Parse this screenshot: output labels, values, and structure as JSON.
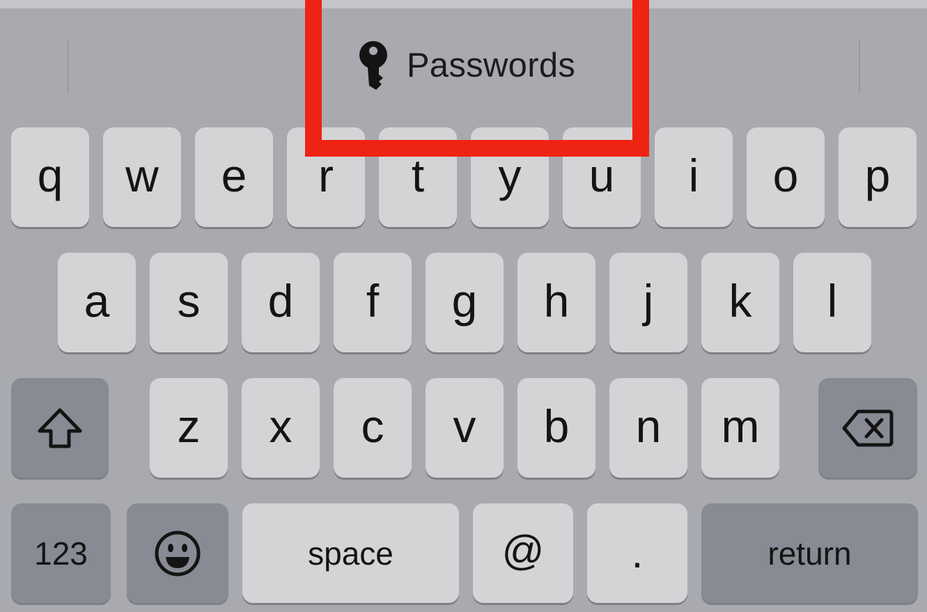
{
  "suggestion_bar": {
    "passwords_label": "Passwords",
    "icon": "key-icon"
  },
  "highlight": {
    "color": "#ef2314"
  },
  "keyboard": {
    "row1": [
      "q",
      "w",
      "e",
      "r",
      "t",
      "y",
      "u",
      "i",
      "o",
      "p"
    ],
    "row2": [
      "a",
      "s",
      "d",
      "f",
      "g",
      "h",
      "j",
      "k",
      "l"
    ],
    "row3": [
      "z",
      "x",
      "c",
      "v",
      "b",
      "n",
      "m"
    ],
    "shift_icon": "shift-arrow-icon",
    "delete_icon": "delete-backspace-icon",
    "numbers_label": "123",
    "emoji_icon": "smiley-face-icon",
    "space_label": "space",
    "at_label": "@",
    "period_label": ".",
    "return_label": "return"
  },
  "colors": {
    "background": "#a9aab0",
    "letter_key": "#d4d4d6",
    "function_key": "#888b93"
  }
}
